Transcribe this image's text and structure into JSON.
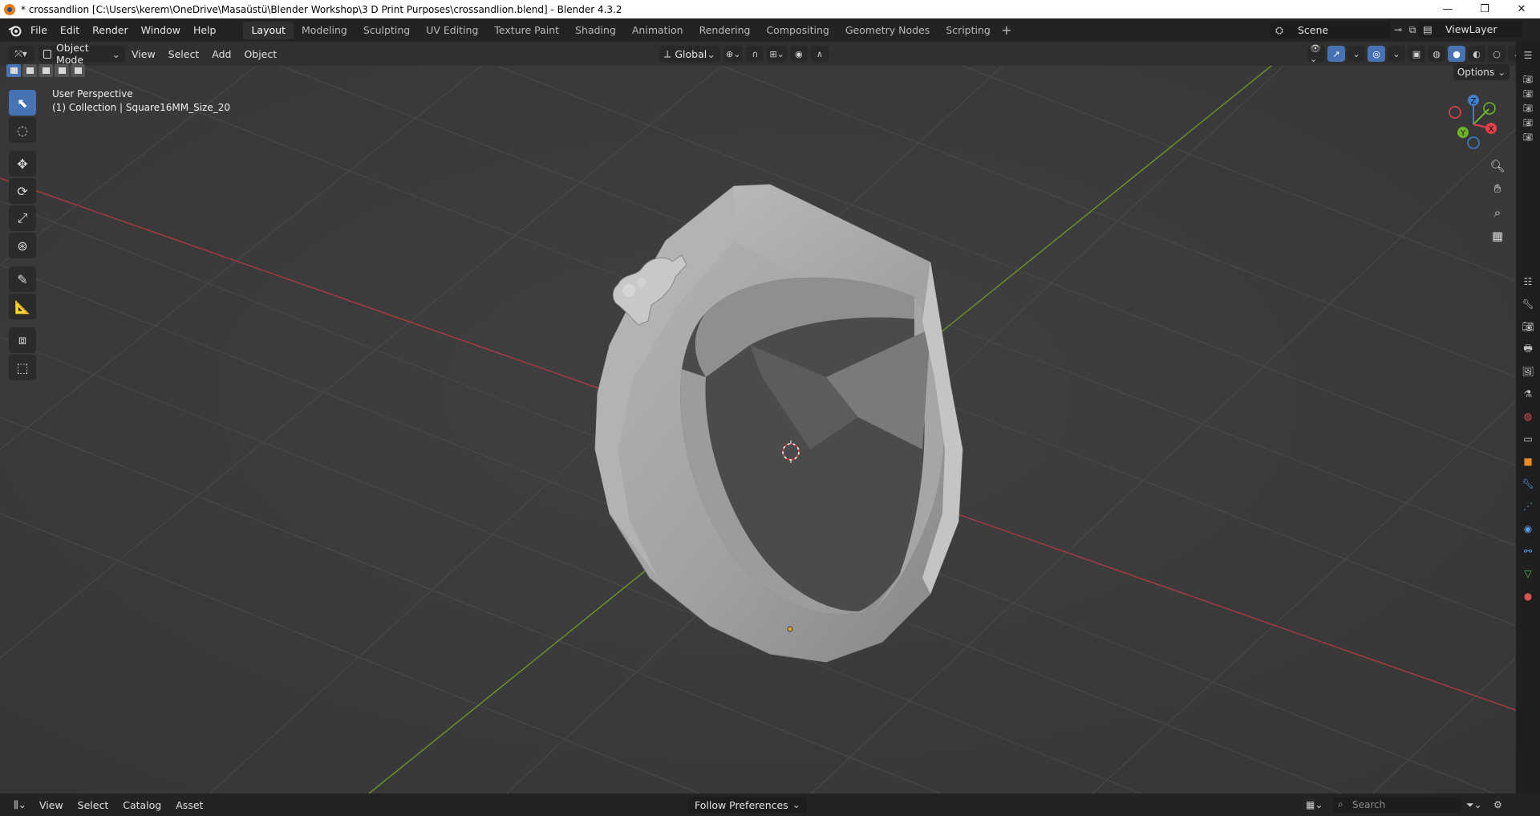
{
  "window": {
    "title": "* crossandlion [C:\\Users\\kerem\\OneDrive\\Masaüstü\\Blender Workshop\\3 D Print Purposes\\crossandlion.blend] - Blender 4.3.2",
    "minimize": "—",
    "maximize": "❐",
    "close": "✕"
  },
  "menubar": {
    "items": [
      "File",
      "Edit",
      "Render",
      "Window",
      "Help"
    ]
  },
  "workspaces": {
    "tabs": [
      "Layout",
      "Modeling",
      "Sculpting",
      "UV Editing",
      "Texture Paint",
      "Shading",
      "Animation",
      "Rendering",
      "Compositing",
      "Geometry Nodes",
      "Scripting"
    ],
    "active": "Layout",
    "add": "+"
  },
  "scene": {
    "label": "Scene"
  },
  "view_layer": {
    "label": "ViewLayer"
  },
  "viewport_header": {
    "mode": "Object Mode",
    "menus": [
      "View",
      "Select",
      "Add",
      "Object"
    ],
    "orientation": "Global"
  },
  "viewport": {
    "perspective": "User Perspective",
    "collection_info": "(1) Collection | Square16MM_Size_20",
    "options": "Options"
  },
  "gizmo": {
    "axes": [
      "Z",
      "Y",
      "X"
    ],
    "colors": {
      "x": "#e0404a",
      "y": "#6cb32a",
      "z": "#3f7ec9"
    }
  },
  "bottombar": {
    "menus": [
      "View",
      "Select",
      "Catalog",
      "Asset"
    ],
    "follow_preferences": "Follow Preferences",
    "search_placeholder": "Search"
  },
  "colors": {
    "accent": "#4772b3",
    "x_axis_line": "#b8383c",
    "y_axis_line": "#6a8f2c",
    "brand_orange": "#e87d0d"
  }
}
